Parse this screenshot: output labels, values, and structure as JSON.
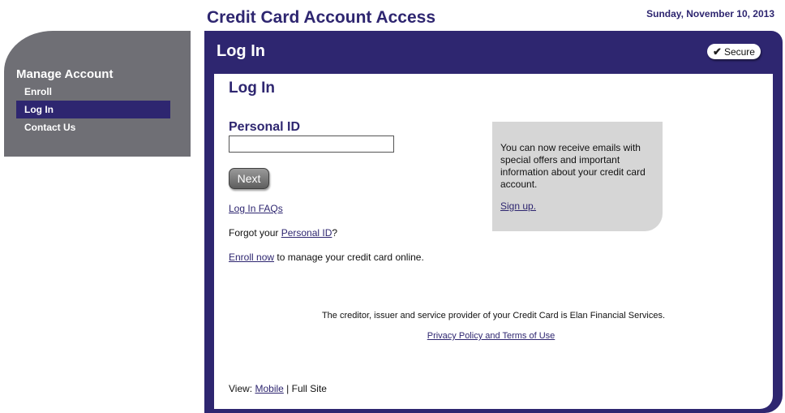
{
  "header": {
    "title": "Credit Card Account Access",
    "date": "Sunday, November 10, 2013"
  },
  "sidebar": {
    "heading": "Manage Account",
    "items": [
      {
        "label": "Enroll"
      },
      {
        "label": "Log In",
        "active": true
      },
      {
        "label": "Contact Us"
      }
    ]
  },
  "panel": {
    "title": "Log In",
    "secure_label": "Secure",
    "secure_icon": "checkmark-icon"
  },
  "login": {
    "heading": "Log In",
    "personal_id_label": "Personal ID",
    "personal_id_value": "",
    "next_label": "Next",
    "faqs_link": "Log In FAQs",
    "forgot_prefix": "Forgot your ",
    "forgot_link": "Personal ID",
    "forgot_suffix": "?",
    "enroll_link": "Enroll now",
    "enroll_suffix": " to manage your credit card online."
  },
  "promo": {
    "text": "You can now receive emails with special offers and important information about your credit card account.",
    "signup_link": "Sign up."
  },
  "footer": {
    "disclaimer": "The creditor, issuer and service provider of your Credit Card is Elan Financial Services.",
    "privacy_link": "Privacy Policy and Terms of Use",
    "view_prefix": "View: ",
    "mobile_link": "Mobile",
    "view_separator": " | ",
    "full_site": "Full Site"
  },
  "colors": {
    "brand": "#2e2670",
    "sidebar_bg": "#6f6f75",
    "promo_bg": "#d6d6d6"
  }
}
